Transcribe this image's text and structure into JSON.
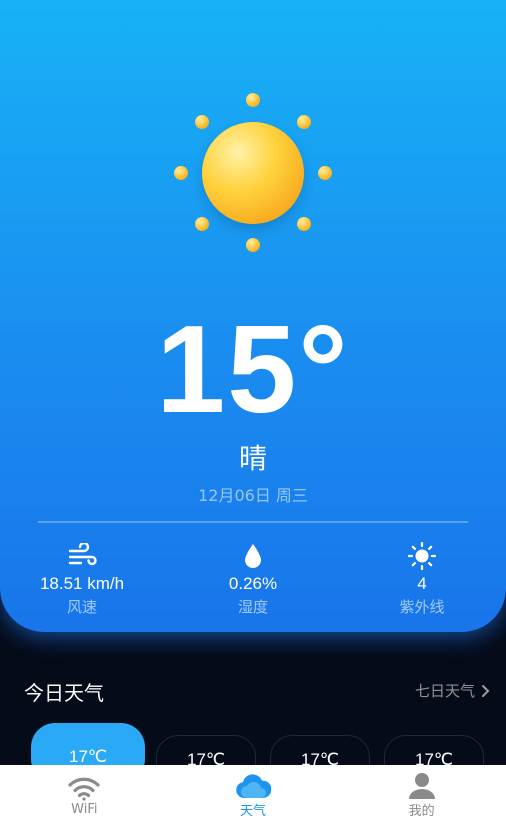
{
  "weather": {
    "icon": "sun-icon",
    "temperature": "15°",
    "condition": "晴",
    "date": "12月06日 周三"
  },
  "stats": [
    {
      "icon": "wind-icon",
      "value": "18.51 km/h",
      "label": "风速"
    },
    {
      "icon": "humidity-drop-icon",
      "value": "0.26%",
      "label": "湿度"
    },
    {
      "icon": "uv-sun-icon",
      "value": "4",
      "label": "紫外线"
    }
  ],
  "today": {
    "title": "今日天气",
    "link_label": "七日天气",
    "hours": [
      {
        "temp": "17℃",
        "active": true
      },
      {
        "temp": "17℃",
        "active": false
      },
      {
        "temp": "17℃",
        "active": false
      },
      {
        "temp": "17℃",
        "active": false
      }
    ]
  },
  "tabs": [
    {
      "icon": "wifi-icon",
      "label": "WiFi",
      "active": false
    },
    {
      "icon": "cloud-icon",
      "label": "天气",
      "active": true
    },
    {
      "icon": "user-icon",
      "label": "我的",
      "active": false
    }
  ],
  "colors": {
    "accent": "#1d95ee",
    "hero_top": "#17b2f5",
    "hero_bottom": "#1875ea",
    "background": "#050b18"
  }
}
